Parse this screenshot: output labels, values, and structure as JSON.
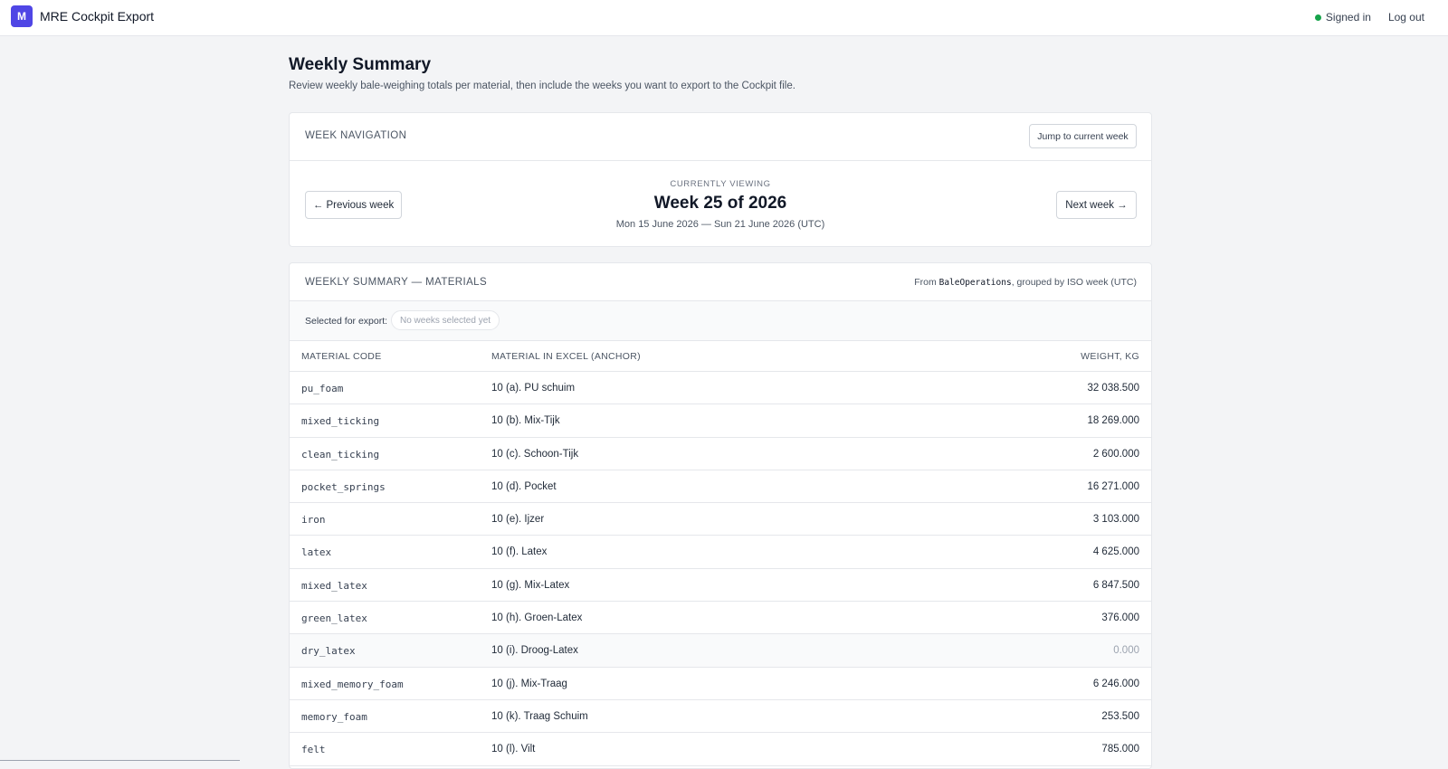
{
  "app": {
    "logo_letter": "M",
    "name": "MRE Cockpit Export"
  },
  "nav": {
    "signed_in": "Signed in",
    "logout": "Log out",
    "status_color": "#16a34a"
  },
  "page": {
    "title": "Weekly Summary",
    "subtitle": "Review weekly bale-weighing totals per material, then include the weeks you want to export to the Cockpit file."
  },
  "week_nav": {
    "title": "Week navigation",
    "jump_label": "Jump to current week",
    "prev_label": "← Previous week",
    "next_label": "Next week →",
    "viewing_label": "Currently viewing",
    "week_title": "Week 25 of 2026",
    "week_range": "Mon 15 June 2026 — Sun 21 June 2026 (UTC)"
  },
  "summary": {
    "title": "Weekly summary — materials",
    "source_prefix": "From ",
    "source_code": "BaleOperations",
    "source_suffix": ", grouped by ISO week (UTC)",
    "export_label": "Selected for export:",
    "export_empty": "No weeks selected yet",
    "columns": {
      "code": "Material code",
      "excel": "Material in Excel (anchor)",
      "weight": "Weight, kg"
    },
    "rows": [
      {
        "code": "pu_foam",
        "excel": "10 (a). PU schuim",
        "weight": "32 038.500"
      },
      {
        "code": "mixed_ticking",
        "excel": "10 (b). Mix-Tijk",
        "weight": "18 269.000"
      },
      {
        "code": "clean_ticking",
        "excel": "10 (c). Schoon-Tijk",
        "weight": "2 600.000"
      },
      {
        "code": "pocket_springs",
        "excel": "10 (d). Pocket",
        "weight": "16 271.000"
      },
      {
        "code": "iron",
        "excel": "10 (e). Ijzer",
        "weight": "3 103.000"
      },
      {
        "code": "latex",
        "excel": "10 (f). Latex",
        "weight": "4 625.000"
      },
      {
        "code": "mixed_latex",
        "excel": "10 (g). Mix-Latex",
        "weight": "6 847.500"
      },
      {
        "code": "green_latex",
        "excel": "10 (h). Groen-Latex",
        "weight": "376.000"
      },
      {
        "code": "dry_latex",
        "excel": "10 (i). Droog-Latex",
        "weight": "0.000"
      },
      {
        "code": "mixed_memory_foam",
        "excel": "10 (j). Mix-Traag",
        "weight": "6 246.000"
      },
      {
        "code": "memory_foam",
        "excel": "10 (k). Traag Schuim",
        "weight": "253.500"
      },
      {
        "code": "felt",
        "excel": "10 (l). Vilt",
        "weight": "785.000"
      }
    ]
  }
}
